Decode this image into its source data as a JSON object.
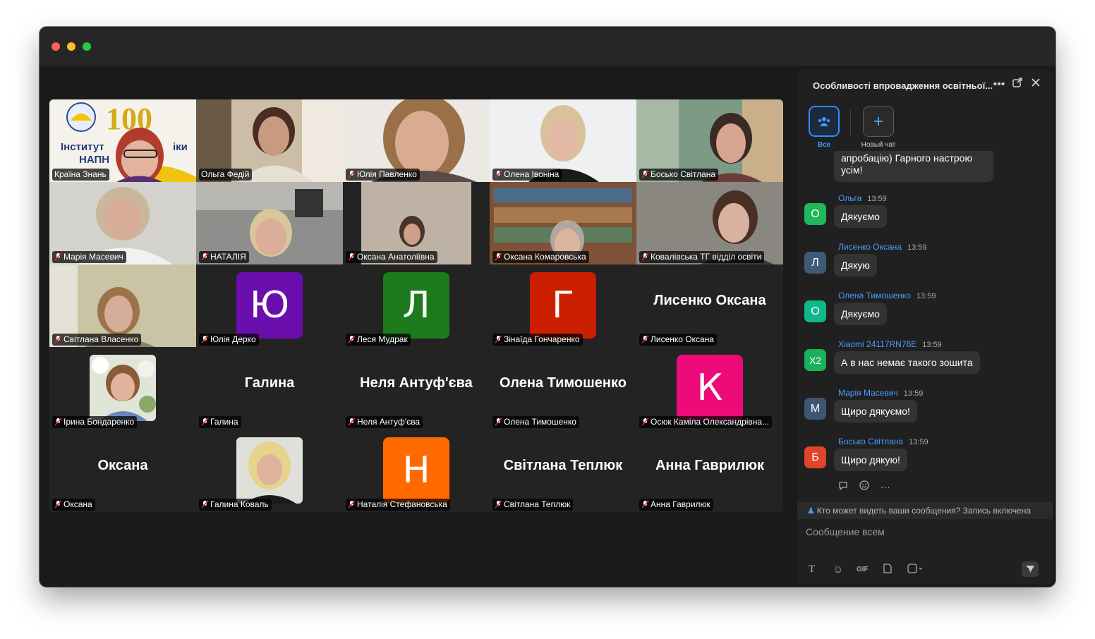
{
  "grid": {
    "tiles": [
      {
        "name": "Країна Знань",
        "kind": "video",
        "logo": "100",
        "logo_text": "Інститут модернізації змісту освіти / педагогіки НАПН",
        "active": true
      },
      {
        "name": "Ольга Федій",
        "kind": "video"
      },
      {
        "name": "Юлія Павленко",
        "kind": "video"
      },
      {
        "name": "Олена Івоніна",
        "kind": "video"
      },
      {
        "name": "Босько Світлана",
        "kind": "video"
      },
      {
        "name": "Марія Масевич",
        "kind": "video"
      },
      {
        "name": "НАТАЛІЯ",
        "kind": "video"
      },
      {
        "name": "Оксана Анатоліївна",
        "kind": "video"
      },
      {
        "name": "Оксана Комаровська",
        "kind": "video"
      },
      {
        "name": "Ковалівська ТГ відділ освіти",
        "kind": "video"
      },
      {
        "name": "Світлана Власенко",
        "kind": "video"
      },
      {
        "name": "Юлія Дерко",
        "kind": "avatar",
        "letter": "Ю",
        "color": "#6a0dad"
      },
      {
        "name": "Леся Мудрак",
        "kind": "avatar",
        "letter": "Л",
        "color": "#1d7a1d"
      },
      {
        "name": "Зінаїда Гончаренко",
        "kind": "avatar",
        "letter": "Г",
        "color": "#cc1f00"
      },
      {
        "name": "Лисенко Оксана",
        "kind": "text",
        "display": "Лисенко Оксана"
      },
      {
        "name": "Ірина Бондаренко",
        "kind": "photo"
      },
      {
        "name": "Галина",
        "kind": "text",
        "display": "Галина"
      },
      {
        "name": "Неля Антуф'єва",
        "kind": "text",
        "display": "Неля Антуф'єва"
      },
      {
        "name": "Олена Тимошенко",
        "kind": "text",
        "display": "Олена Тимошенко"
      },
      {
        "name": "Осюк Каміла Олександрівна...",
        "kind": "avatar",
        "letter": "К",
        "color": "#ee0a78"
      },
      {
        "name": "Оксана",
        "kind": "text",
        "display": "Оксана"
      },
      {
        "name": "Галина Коваль",
        "kind": "photo"
      },
      {
        "name": "Наталія Стефановська",
        "kind": "avatar",
        "letter": "Н",
        "color": "#ff6a00"
      },
      {
        "name": "Світлана Теплюк",
        "kind": "text",
        "display": "Світлана Теплюк"
      },
      {
        "name": "Анна Гаврилюк",
        "kind": "text",
        "display": "Анна Гаврилюк"
      }
    ]
  },
  "chat": {
    "title": "Особливості впровадження освітньої...",
    "tabs": [
      {
        "label": "Все",
        "icon": "group-icon",
        "selected": true
      },
      {
        "label": "Новый чат",
        "icon": "plus-icon",
        "selected": false
      }
    ],
    "previous_message": "апробацію) Гарного настрою усім!",
    "messages": [
      {
        "sender": "Ольга",
        "time": "13:59",
        "text": "Дякуємо",
        "initial": "О",
        "color": "#1fb85a"
      },
      {
        "sender": "Лисенко Оксана",
        "time": "13:59",
        "text": "Дякую",
        "initial": "Л",
        "color": "#3f5a78"
      },
      {
        "sender": "Олена Тимошенко",
        "time": "13:59",
        "text": "Дякуємо",
        "initial": "О",
        "color": "#0fb88a"
      },
      {
        "sender": "Xiaomi 24117RN76E",
        "time": "13:59",
        "text": "А в нас немає такого зошита",
        "initial": "X2",
        "color": "#19b15b"
      },
      {
        "sender": "Марія Масевич",
        "time": "13:59",
        "text": "Щиро дякуємо!",
        "initial": "М",
        "color": "#3e5573"
      },
      {
        "sender": "Босько Світлана",
        "time": "13:59",
        "text": "Щиро дякую!",
        "initial": "Б",
        "color": "#e0452b"
      }
    ],
    "reactions": [
      "reply-icon",
      "emoji-icon",
      "more-icon"
    ],
    "notice": "Кто может видеть ваши сообщения? Запись включена",
    "input_placeholder": "Сообщение всем",
    "toolbar": {
      "format": "T",
      "emoji": "☺",
      "gif": "GIF",
      "file": "▯",
      "screenshot": "▢",
      "send": "send-icon"
    }
  }
}
